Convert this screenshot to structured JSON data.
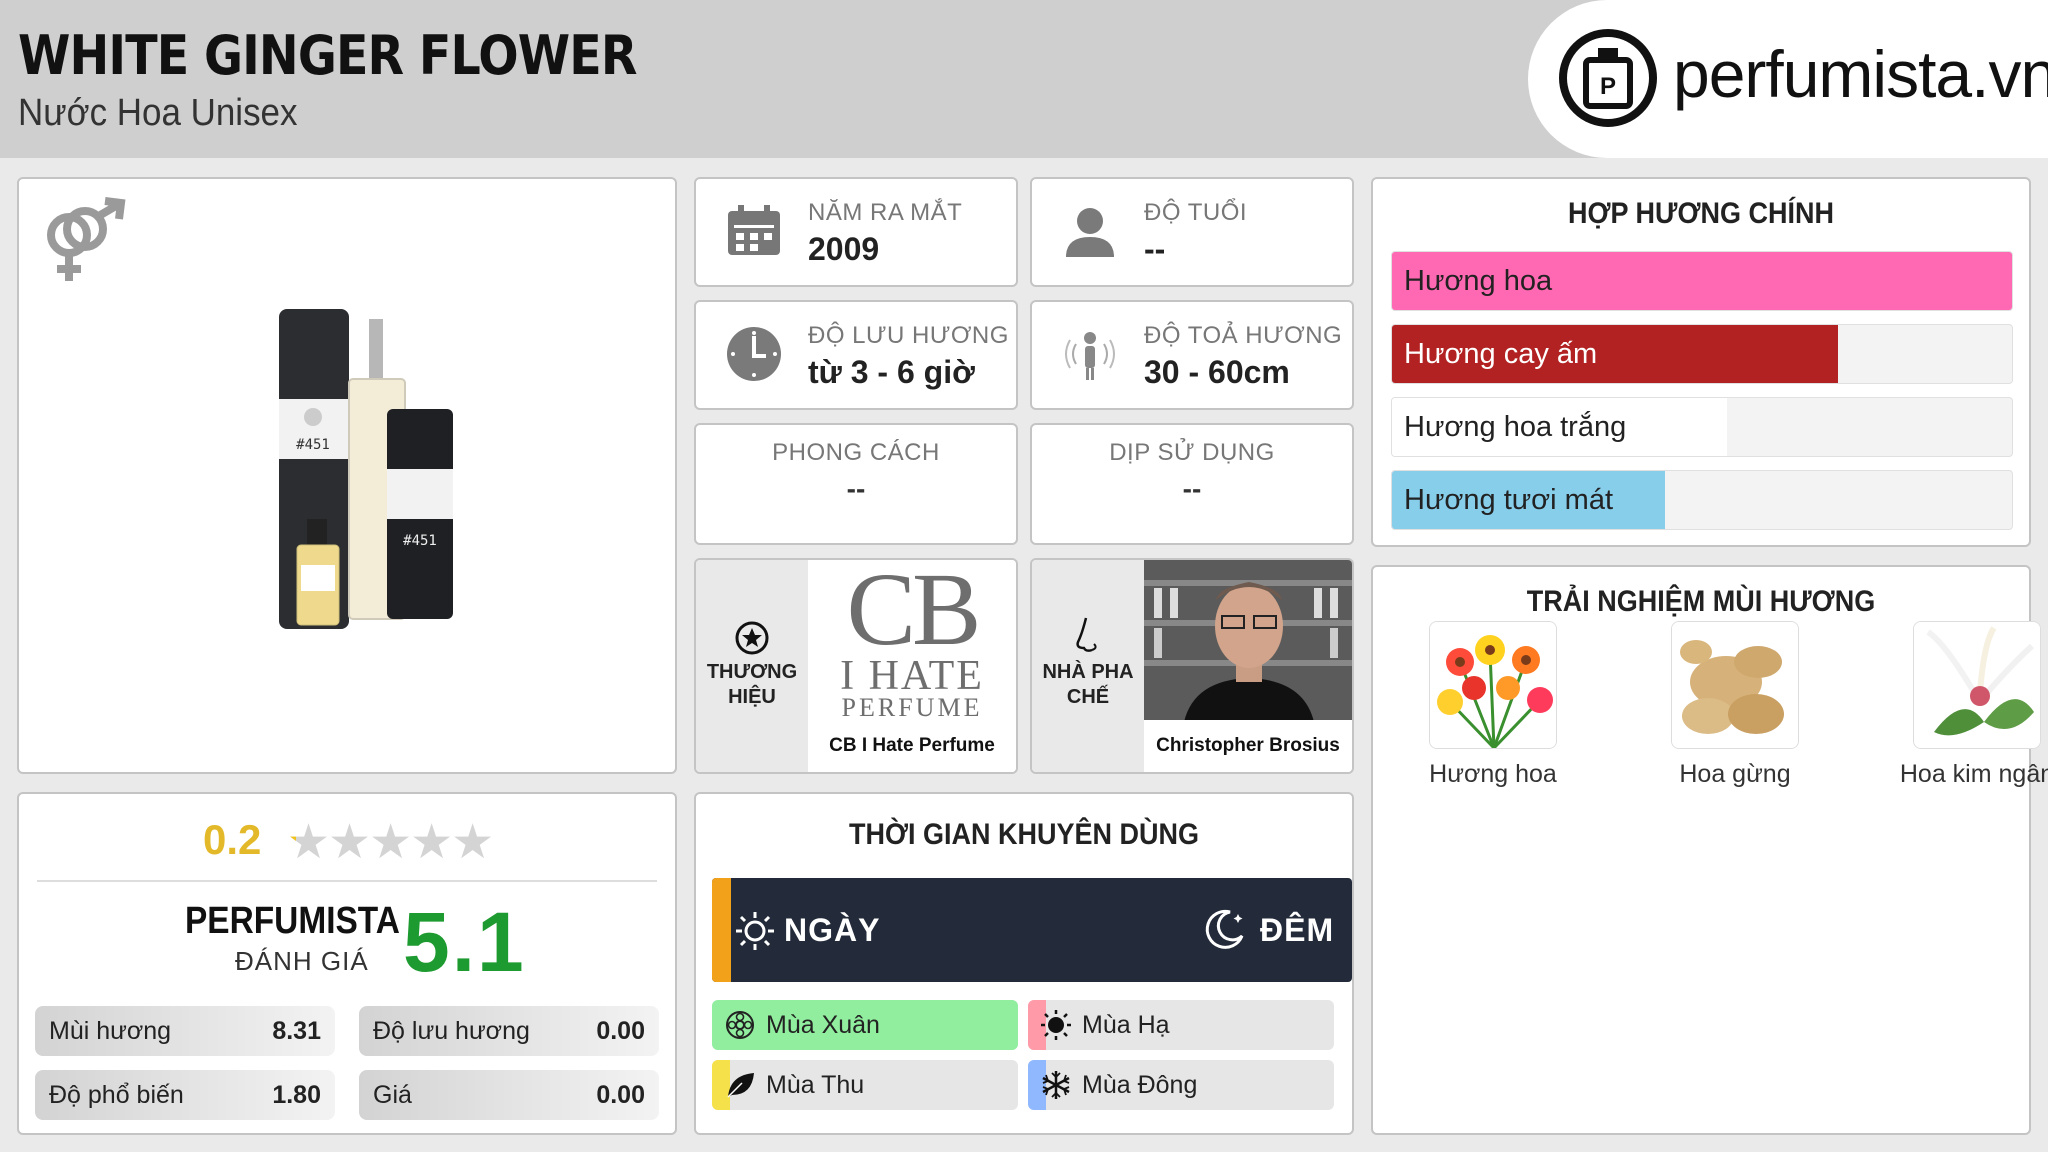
{
  "header": {
    "title": "WHITE GINGER FLOWER",
    "subtitle": "Nước Hoa Unisex",
    "logo_text": "perfumista.vn"
  },
  "info": {
    "launch_label": "NĂM RA MẮT",
    "launch_value": "2009",
    "age_label": "ĐỘ TUỔI",
    "age_value": "--",
    "longevity_label": "ĐỘ LƯU HƯƠNG",
    "longevity_value": "từ 3 - 6 giờ",
    "sillage_label": "ĐỘ TOẢ HƯƠNG",
    "sillage_value": "30 - 60cm",
    "style_label": "PHONG CÁCH",
    "style_value": "--",
    "occasion_label": "DỊP SỬ DỤNG",
    "occasion_value": "--"
  },
  "brand": {
    "label": "THƯƠNG HIỆU",
    "logo_line1": "CB",
    "logo_line2": "I HATE",
    "logo_line3": "PERFUME",
    "name": "CB I Hate Perfume"
  },
  "perfumer": {
    "label": "NHÀ PHA CHẾ",
    "name": "Christopher Brosius"
  },
  "accords": {
    "title": "HỢP HƯƠNG CHÍNH",
    "items": [
      {
        "label": "Hương hoa",
        "level": 1.0,
        "color": "#ff69b4"
      },
      {
        "label": "Hương cay ấm",
        "level": 0.72,
        "color": "#b22222"
      },
      {
        "label": "Hương hoa trắng",
        "level": 0.54,
        "color": "#ffffff"
      },
      {
        "label": "Hương tươi mát",
        "level": 0.44,
        "color": "#87ceeb"
      }
    ]
  },
  "notes": {
    "title": "TRẢI NGHIỆM MÙI HƯƠNG",
    "items": [
      {
        "label": "Hương hoa"
      },
      {
        "label": "Hoa gừng"
      },
      {
        "label": "Hoa kim ngân"
      }
    ]
  },
  "rating": {
    "user_score": "0.2",
    "user_stars": 0.04,
    "pf_name": "PERFUMISTA",
    "pf_sub": "ĐÁNH GIÁ",
    "pf_score": "5.1",
    "metrics": [
      {
        "label": "Mùi hương",
        "value": "8.31"
      },
      {
        "label": "Độ lưu hương",
        "value": "0.00"
      },
      {
        "label": "Độ phổ biến",
        "value": "1.80"
      },
      {
        "label": "Giá",
        "value": "0.00"
      }
    ]
  },
  "usage": {
    "title": "THỜI GIAN KHUYÊN DÙNG",
    "day_label": "NGÀY",
    "night_label": "ĐÊM",
    "day_level": 0.03,
    "seasons": [
      {
        "label": "Mùa Xuân",
        "level": 1.0,
        "color": "#90ee9e"
      },
      {
        "label": "Mùa Hạ",
        "level": 0.06,
        "color": "#ff9aa8"
      },
      {
        "label": "Mùa Thu",
        "level": 0.06,
        "color": "#f5e14a"
      },
      {
        "label": "Mùa Đông",
        "level": 0.06,
        "color": "#8fb8ff"
      }
    ]
  }
}
